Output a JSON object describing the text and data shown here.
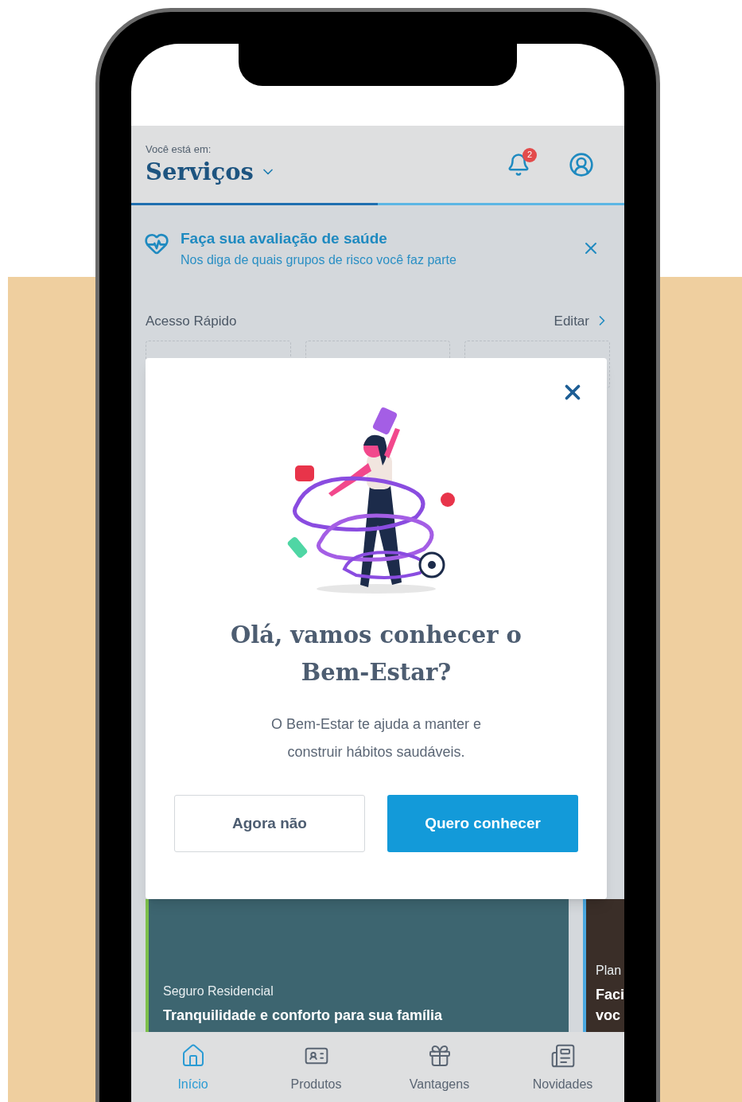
{
  "header": {
    "caption": "Você está em:",
    "title": "Serviços",
    "notification_count": "2",
    "progress": {
      "level": 0.5
    }
  },
  "banner": {
    "title": "Faça sua avaliação de saúde",
    "subtitle": "Nos diga de quais grupos de risco você faz parte"
  },
  "quick_access": {
    "title": "Acesso Rápido",
    "action": "Editar"
  },
  "modal": {
    "title": "Olá, vamos conhecer o Bem-Estar?",
    "body": "O Bem-Estar te ajuda a manter e construir hábitos saudáveis.",
    "buttons": [
      {
        "label": "Agora não",
        "kind": "secondary"
      },
      {
        "label": "Quero conhecer",
        "kind": "primary"
      }
    ]
  },
  "cards": [
    {
      "eyebrow": "Seguro Residencial",
      "headline": "Tranquilidade e conforto para sua família",
      "color": "#7cc04b"
    },
    {
      "eyebrow": "Plan",
      "headline": "Faci voc",
      "color": "#4aa8e0"
    }
  ],
  "nav": [
    {
      "label": "Início",
      "selected": true
    },
    {
      "label": "Produtos",
      "selected": false
    },
    {
      "label": "Vantagens",
      "selected": false
    },
    {
      "label": "Novidades",
      "selected": false
    }
  ]
}
